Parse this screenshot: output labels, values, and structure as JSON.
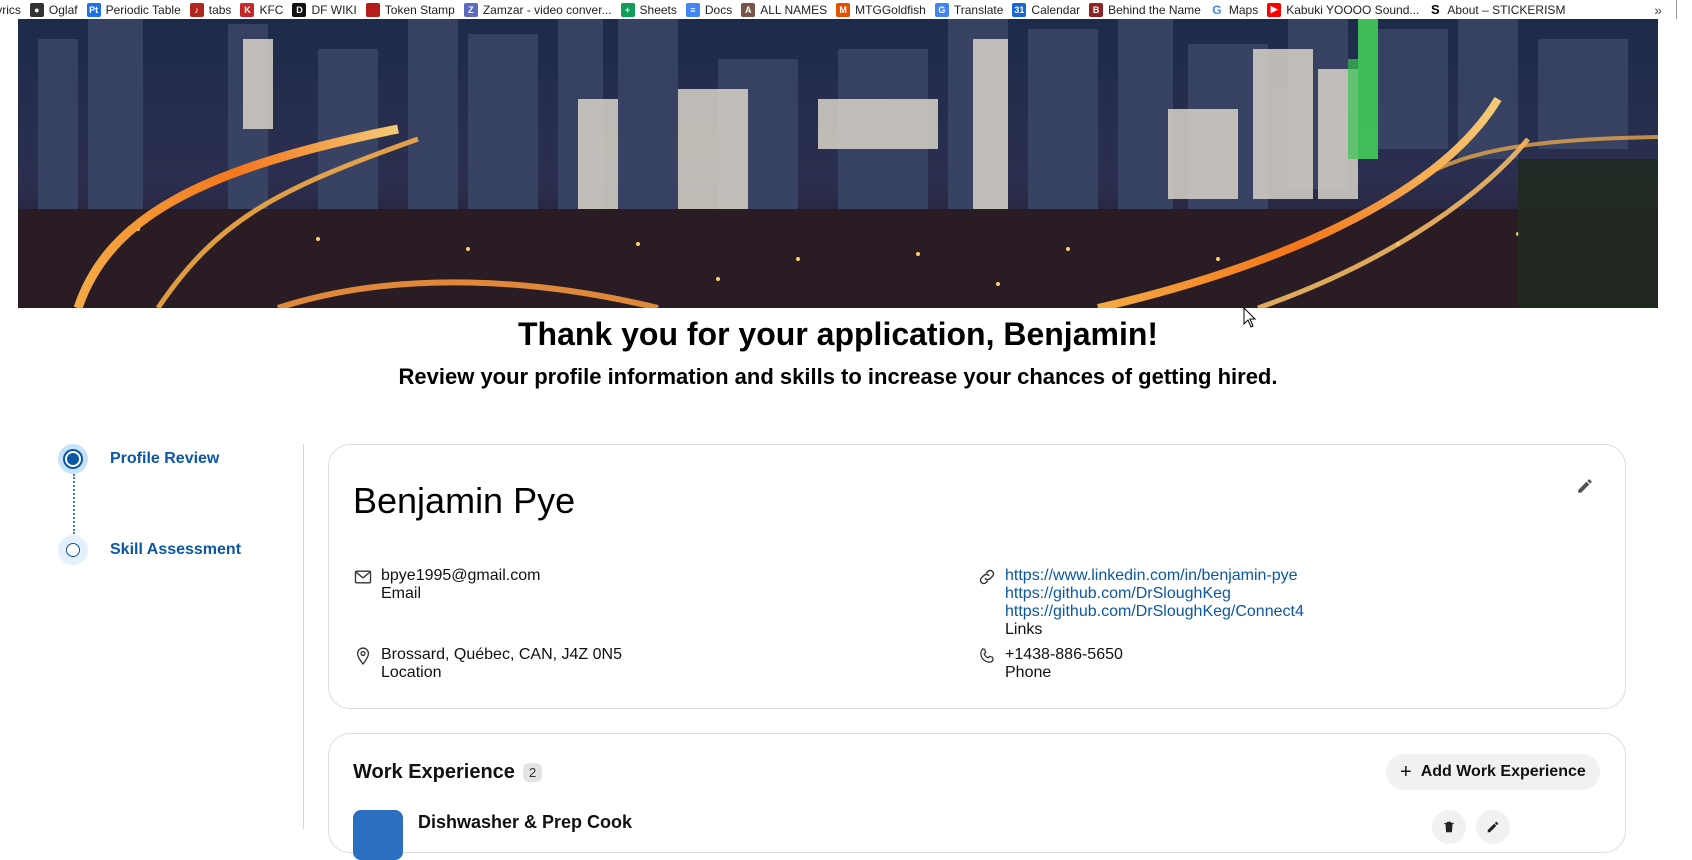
{
  "bookmarks": [
    {
      "label": "Lyrics",
      "icon": "lyrics-icon",
      "color": "#ffffff"
    },
    {
      "label": "Oglaf",
      "icon": "oglaf-icon",
      "color": "#333333"
    },
    {
      "label": "Periodic Table",
      "icon": "periodic-table-icon",
      "color": "#1a73e8"
    },
    {
      "label": "tabs",
      "icon": "guitar-icon",
      "color": "#b3261e"
    },
    {
      "label": "KFC",
      "icon": "kfc-icon",
      "color": "#c62828"
    },
    {
      "label": "DF WIKI",
      "icon": "df-wiki-icon",
      "color": "#111111"
    },
    {
      "label": "Token Stamp",
      "icon": "token-stamp-icon",
      "color": "#b71c1c"
    },
    {
      "label": "Zamzar - video conver...",
      "icon": "zamzar-icon",
      "color": "#5c6bc0"
    },
    {
      "label": "Sheets",
      "icon": "sheets-icon",
      "color": "#0f9d58"
    },
    {
      "label": "Docs",
      "icon": "docs-icon",
      "color": "#4285f4"
    },
    {
      "label": "ALL NAMES",
      "icon": "all-names-icon",
      "color": "#795548"
    },
    {
      "label": "MTGGoldfish",
      "icon": "mtggoldfish-icon",
      "color": "#e65100"
    },
    {
      "label": "Translate",
      "icon": "translate-icon",
      "color": "#4285f4"
    },
    {
      "label": "Calendar",
      "icon": "calendar-icon",
      "color": "#1967d2"
    },
    {
      "label": "Behind the Name",
      "icon": "behind-the-name-icon",
      "color": "#8e2424"
    },
    {
      "label": "Maps",
      "icon": "google-icon",
      "color": "#4285f4"
    },
    {
      "label": "Kabuki YOOOO Sound...",
      "icon": "youtube-icon",
      "color": "#ff0000"
    },
    {
      "label": "About – STICKERISM",
      "icon": "stickerism-icon",
      "color": "#000000"
    }
  ],
  "page": {
    "headline": "Thank you for your application, Benjamin!",
    "subline": "Review your profile information and skills to increase your chances of getting hired."
  },
  "stepper": {
    "steps": [
      {
        "label": "Profile Review",
        "state": "active"
      },
      {
        "label": "Skill Assessment",
        "state": "pending"
      }
    ],
    "accent": "#0b57a4"
  },
  "profile": {
    "name": "Benjamin Pye",
    "email": {
      "value": "bpye1995@gmail.com",
      "caption": "Email"
    },
    "location": {
      "value": "Brossard, Québec, CAN, J4Z 0N5",
      "caption": "Location"
    },
    "links": {
      "items": [
        "https://www.linkedin.com/in/benjamin-pye",
        "https://github.com/DrSloughKeg",
        "https://github.com/DrSloughKeg/Connect4"
      ],
      "caption": "Links"
    },
    "phone": {
      "value": "+1438-886-5650",
      "caption": "Phone"
    }
  },
  "work": {
    "title": "Work Experience",
    "count": "2",
    "add_label": "Add Work Experience",
    "first_job_title": "Dishwasher & Prep Cook"
  }
}
